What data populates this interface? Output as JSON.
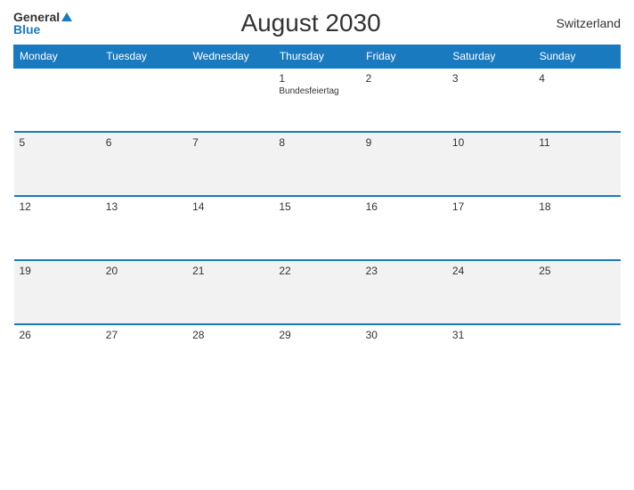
{
  "header": {
    "logo_general": "General",
    "logo_blue": "Blue",
    "title": "August 2030",
    "country": "Switzerland"
  },
  "weekdays": [
    "Monday",
    "Tuesday",
    "Wednesday",
    "Thursday",
    "Friday",
    "Saturday",
    "Sunday"
  ],
  "weeks": [
    [
      {
        "day": "",
        "holiday": ""
      },
      {
        "day": "",
        "holiday": ""
      },
      {
        "day": "",
        "holiday": ""
      },
      {
        "day": "1",
        "holiday": "Bundesfeiertag"
      },
      {
        "day": "2",
        "holiday": ""
      },
      {
        "day": "3",
        "holiday": ""
      },
      {
        "day": "4",
        "holiday": ""
      }
    ],
    [
      {
        "day": "5",
        "holiday": ""
      },
      {
        "day": "6",
        "holiday": ""
      },
      {
        "day": "7",
        "holiday": ""
      },
      {
        "day": "8",
        "holiday": ""
      },
      {
        "day": "9",
        "holiday": ""
      },
      {
        "day": "10",
        "holiday": ""
      },
      {
        "day": "11",
        "holiday": ""
      }
    ],
    [
      {
        "day": "12",
        "holiday": ""
      },
      {
        "day": "13",
        "holiday": ""
      },
      {
        "day": "14",
        "holiday": ""
      },
      {
        "day": "15",
        "holiday": ""
      },
      {
        "day": "16",
        "holiday": ""
      },
      {
        "day": "17",
        "holiday": ""
      },
      {
        "day": "18",
        "holiday": ""
      }
    ],
    [
      {
        "day": "19",
        "holiday": ""
      },
      {
        "day": "20",
        "holiday": ""
      },
      {
        "day": "21",
        "holiday": ""
      },
      {
        "day": "22",
        "holiday": ""
      },
      {
        "day": "23",
        "holiday": ""
      },
      {
        "day": "24",
        "holiday": ""
      },
      {
        "day": "25",
        "holiday": ""
      }
    ],
    [
      {
        "day": "26",
        "holiday": ""
      },
      {
        "day": "27",
        "holiday": ""
      },
      {
        "day": "28",
        "holiday": ""
      },
      {
        "day": "29",
        "holiday": ""
      },
      {
        "day": "30",
        "holiday": ""
      },
      {
        "day": "31",
        "holiday": ""
      },
      {
        "day": "",
        "holiday": ""
      }
    ]
  ]
}
